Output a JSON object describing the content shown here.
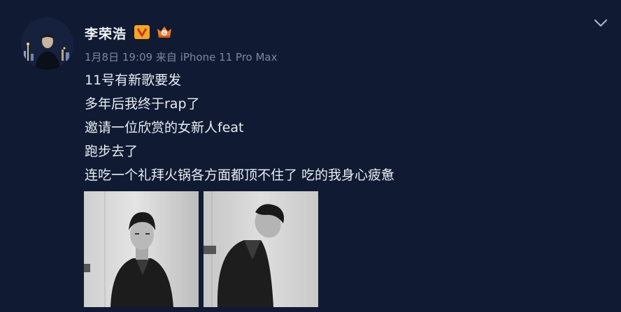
{
  "post": {
    "author": "李荣浩",
    "meta": {
      "date_time": "1月8日 19:09",
      "source_prefix": "来自",
      "source_device": "iPhone 11 Pro Max"
    },
    "content_lines": [
      "11号有新歌要发",
      "多年后我终于rap了",
      "邀请一位欣赏的女新人feat",
      "跑步去了",
      "连吃一个礼拜火锅各方面都顶不住了 吃的我身心疲惫"
    ],
    "badges": {
      "verified_icon": "verified-v-icon",
      "member_icon": "crown-member-icon"
    },
    "colors": {
      "background": "#101b33",
      "verified": "#f5a623",
      "member": "#f07a2a",
      "meta_text": "#7d879c"
    },
    "photos": [
      {
        "icon": "photo-portrait-front"
      },
      {
        "icon": "photo-portrait-head-down"
      }
    ]
  }
}
